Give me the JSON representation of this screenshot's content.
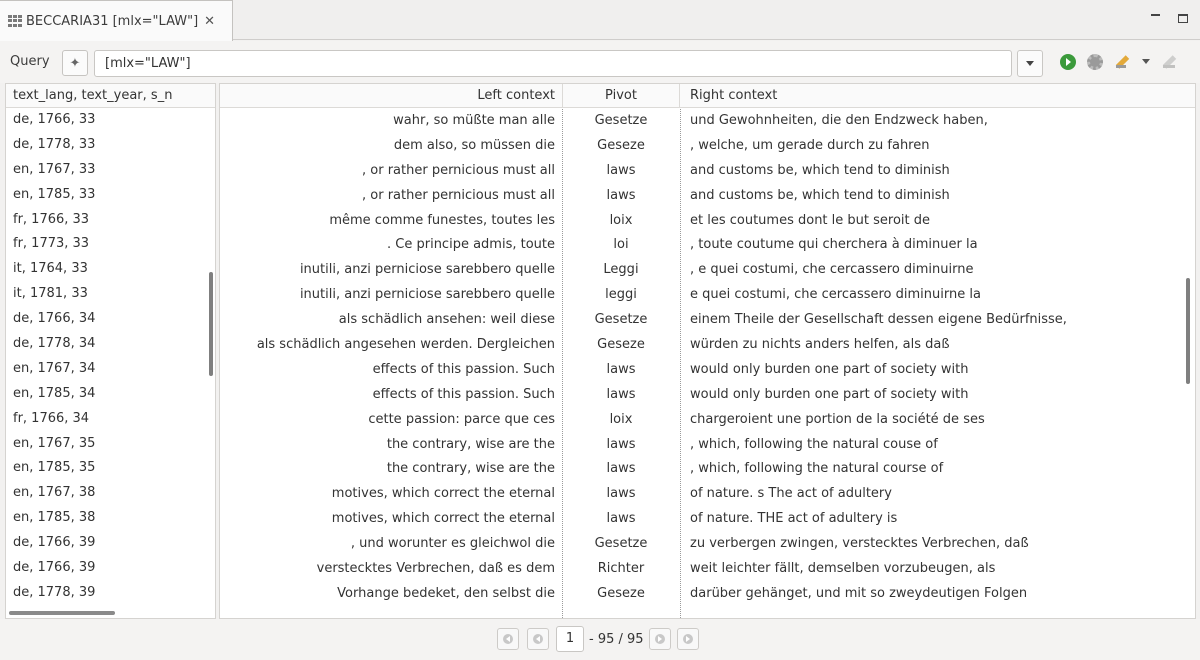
{
  "tab": {
    "title": "BECCARIA31 [mlx=\"LAW\"]",
    "close": "✕"
  },
  "query": {
    "label": "Query",
    "value": "[mlx=\"LAW\"]"
  },
  "left": {
    "header": "text_lang, text_year, s_n",
    "rows": [
      "de, 1766, 33",
      "de, 1778, 33",
      "en, 1767, 33",
      "en, 1785, 33",
      "fr, 1766, 33",
      "fr, 1773, 33",
      "it, 1764, 33",
      "it, 1781, 33",
      "de, 1766, 34",
      "de, 1778, 34",
      "en, 1767, 34",
      "en, 1785, 34",
      "fr, 1766, 34",
      "en, 1767, 35",
      "en, 1785, 35",
      "en, 1767, 38",
      "en, 1785, 38",
      "de, 1766, 39",
      "de, 1766, 39",
      "de, 1778, 39"
    ]
  },
  "concordance": {
    "headers": {
      "left": "Left context",
      "pivot": "Pivot",
      "right": "Right context"
    },
    "rows": [
      {
        "left": "wahr, so müßte man alle",
        "pivot": "Gesetze",
        "right": "und Gewohnheiten, die den Endzweck haben,"
      },
      {
        "left": "dem also, so müssen die",
        "pivot": "Geseze",
        "right": ", welche, um gerade durch zu fahren"
      },
      {
        "left": ", or rather pernicious must all",
        "pivot": "laws",
        "right": "and customs be, which tend to diminish"
      },
      {
        "left": ", or rather pernicious must all",
        "pivot": "laws",
        "right": "and customs be, which tend to diminish"
      },
      {
        "left": "même comme funestes, toutes les",
        "pivot": "loix",
        "right": "et les coutumes dont le but seroit de"
      },
      {
        "left": ". Ce principe admis, toute",
        "pivot": "loi",
        "right": ", toute coutume qui cherchera à diminuer la"
      },
      {
        "left": "inutili, anzi perniciose sarebbero quelle",
        "pivot": "Leggi",
        "right": ", e quei costumi, che cercassero diminuirne"
      },
      {
        "left": "inutili, anzi perniciose sarebbero quelle",
        "pivot": "leggi",
        "right": "e quei costumi, che cercassero diminuirne la"
      },
      {
        "left": "als schädlich ansehen: weil diese",
        "pivot": "Gesetze",
        "right": "einem Theile der Gesellschaft dessen eigene Bedürfnisse,"
      },
      {
        "left": "als schädlich angesehen werden. Dergleichen",
        "pivot": "Geseze",
        "right": "würden zu nichts anders helfen, als daß"
      },
      {
        "left": "effects of this passion. Such",
        "pivot": "laws",
        "right": "would only burden one part of society with"
      },
      {
        "left": "effects of this passion. Such",
        "pivot": "laws",
        "right": "would only burden one part of society with"
      },
      {
        "left": "cette passion: parce que ces",
        "pivot": "loix",
        "right": "chargeroient une portion de la société de ses"
      },
      {
        "left": "the contrary, wise are the",
        "pivot": "laws",
        "right": ", which, following the natural couse of"
      },
      {
        "left": "the contrary, wise are the",
        "pivot": "laws",
        "right": ", which, following the natural course of"
      },
      {
        "left": "motives, which correct the eternal",
        "pivot": "laws",
        "right": "of nature. s The act of adultery"
      },
      {
        "left": "motives, which correct the eternal",
        "pivot": "laws",
        "right": "of nature. THE act of adultery is"
      },
      {
        "left": ", und worunter es gleichwol die",
        "pivot": "Gesetze",
        "right": "zu verbergen zwingen, verstecktes Verbrechen, daß"
      },
      {
        "left": "verstecktes Verbrechen, daß es dem",
        "pivot": "Richter",
        "right": "weit leichter fällt, demselben vorzubeugen, als"
      },
      {
        "left": "Vorhange bedeket, den selbst die",
        "pivot": "Geseze",
        "right": "darüber gehänget, und mit so zweydeutigen Folgen"
      }
    ]
  },
  "pager": {
    "current": "1",
    "total": "- 95 / 95"
  }
}
